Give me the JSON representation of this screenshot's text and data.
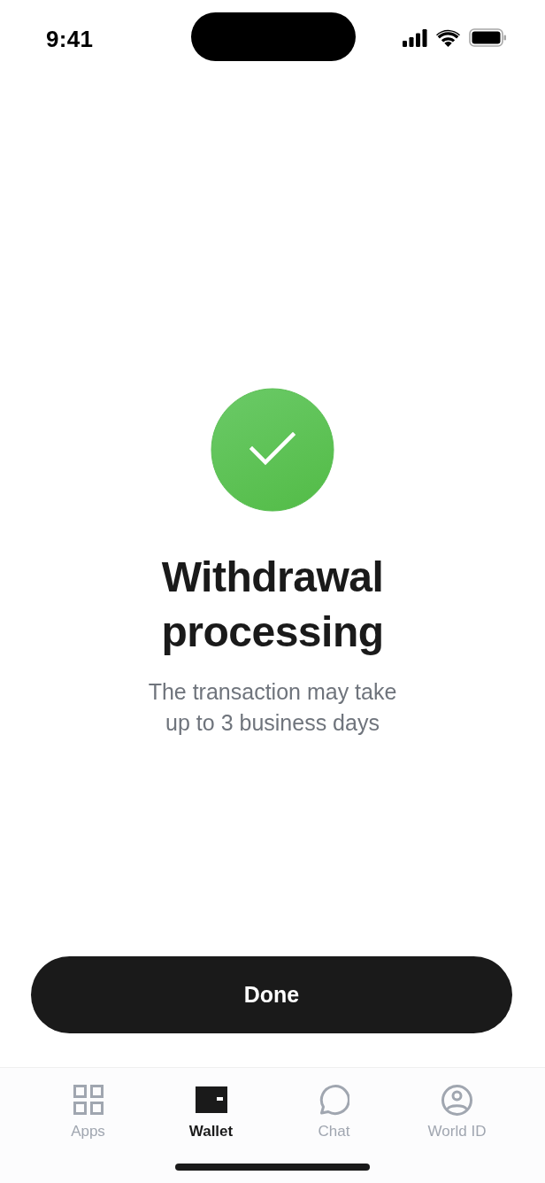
{
  "status_bar": {
    "time": "9:41"
  },
  "result": {
    "title": "Withdrawal processing",
    "message": "The transaction may take up to 3 business days"
  },
  "primary_button": {
    "label": "Done"
  },
  "tab_bar": {
    "tabs": [
      {
        "kind": "grid",
        "label": "Apps",
        "selected": false
      },
      {
        "kind": "wallet",
        "label": "Wallet",
        "selected": true
      },
      {
        "kind": "chat",
        "label": "Chat",
        "selected": false
      },
      {
        "kind": "profile",
        "label": "World ID",
        "selected": false
      }
    ]
  }
}
